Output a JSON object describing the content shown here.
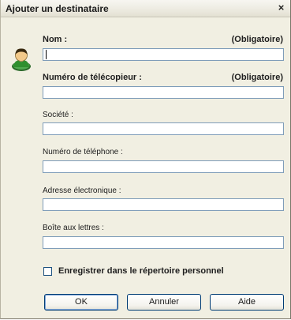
{
  "window": {
    "title": "Ajouter un destinataire",
    "close_glyph": "×"
  },
  "form": {
    "name": {
      "label": "Nom :",
      "required": "(Obligatoire)",
      "value": ""
    },
    "fax": {
      "label": "Numéro de télécopieur :",
      "required": "(Obligatoire)",
      "value": ""
    },
    "company": {
      "label": "Société :",
      "value": ""
    },
    "phone": {
      "label": "Numéro de téléphone :",
      "value": ""
    },
    "email": {
      "label": "Adresse électronique :",
      "value": ""
    },
    "mailbox": {
      "label": "Boîte aux lettres :",
      "value": ""
    }
  },
  "save_to_personal": {
    "label": "Enregistrer dans le répertoire personnel",
    "checked": false
  },
  "buttons": {
    "ok": "OK",
    "cancel": "Annuler",
    "help": "Aide"
  },
  "icons": {
    "contact": "person-icon",
    "close": "close-icon"
  },
  "colors": {
    "dialog_bg": "#f1efe2",
    "input_border": "#7f9db9",
    "button_border": "#003c74"
  }
}
